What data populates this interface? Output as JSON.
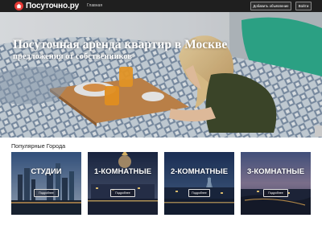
{
  "navbar": {
    "brand": "Посуточно.ру",
    "home_link": "Главная",
    "add_listing_button": "Добавить объявление",
    "login_button": "Войти"
  },
  "hero": {
    "title": "Посуточная аренда квартир в Москве",
    "subtitle": "предложения от собственников"
  },
  "popular": {
    "title": "Популярные Города",
    "cards": [
      {
        "title": "СТУДИИ",
        "button": "Подробнее"
      },
      {
        "title": "1-КОМНАТНЫЕ",
        "button": "Подробнее"
      },
      {
        "title": "2-КОМНАТНЫЕ",
        "button": "Подробнее"
      },
      {
        "title": "3-КОМНАТНЫЕ",
        "button": "Подробнее"
      }
    ]
  },
  "colors": {
    "navbar_bg": "#1f1f1f",
    "brand_icon": "#e53935",
    "button_border": "#8c8c8c"
  },
  "icons": {
    "brand": "house-icon"
  }
}
